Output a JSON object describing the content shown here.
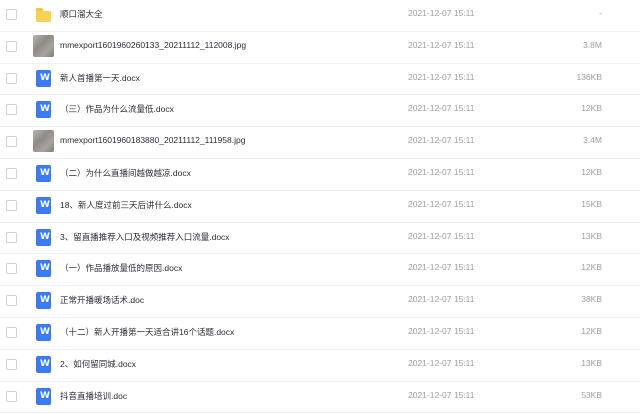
{
  "files": [
    {
      "icon": "folder-icon",
      "name": "顺口溜大全",
      "date": "2021-12-07 15:11",
      "size": "-"
    },
    {
      "icon": "image-thumbnail",
      "name": "mmexport1601960260133_20211112_112008.jpg",
      "date": "2021-12-07 15:11",
      "size": "3.8M"
    },
    {
      "icon": "word-doc-icon",
      "name": "新人首播第一天.docx",
      "date": "2021-12-07 15:11",
      "size": "136KB"
    },
    {
      "icon": "word-doc-icon",
      "name": "（三）作品为什么流量低.docx",
      "date": "2021-12-07 15:11",
      "size": "12KB"
    },
    {
      "icon": "image-thumbnail",
      "name": "mmexport1601960183880_20211112_111958.jpg",
      "date": "2021-12-07 15:11",
      "size": "3.4M"
    },
    {
      "icon": "word-doc-icon",
      "name": "（二）为什么直播间越做越凉.docx",
      "date": "2021-12-07 15:11",
      "size": "12KB"
    },
    {
      "icon": "word-doc-icon",
      "name": "18、新人度过前三天后讲什么.docx",
      "date": "2021-12-07 15:11",
      "size": "15KB"
    },
    {
      "icon": "word-doc-icon",
      "name": "3、留直播推荐入口及视频推荐入口流量.docx",
      "date": "2021-12-07 15:11",
      "size": "13KB"
    },
    {
      "icon": "word-doc-icon",
      "name": "（一）作品播放量低的原因.docx",
      "date": "2021-12-07 15:11",
      "size": "12KB"
    },
    {
      "icon": "word-doc-icon",
      "name": "正常开播暖场话术.doc",
      "date": "2021-12-07 15:11",
      "size": "38KB"
    },
    {
      "icon": "word-doc-icon",
      "name": "（十二）新人开播第一天适合讲16个话题.docx",
      "date": "2021-12-07 15:11",
      "size": "12KB"
    },
    {
      "icon": "word-doc-icon",
      "name": "2、如何留同城.docx",
      "date": "2021-12-07 15:11",
      "size": "13KB"
    },
    {
      "icon": "word-doc-icon",
      "name": "抖音直播培训.doc",
      "date": "2021-12-07 15:11",
      "size": "53KB"
    }
  ]
}
